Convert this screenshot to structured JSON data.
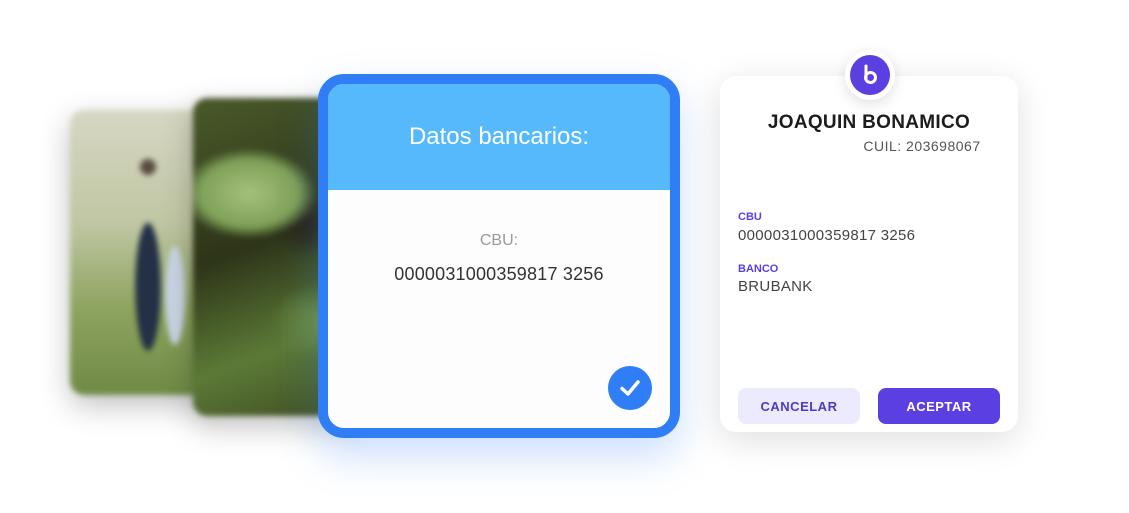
{
  "bank_card": {
    "title": "Datos bancarios:",
    "cbu_label": "CBU:",
    "cbu_value": "0000031000359817 3256",
    "check_icon": "check-circle-icon",
    "colors": {
      "border": "#2f7ef6",
      "header": "#55b9fb"
    }
  },
  "confirm_card": {
    "logo_icon": "brubank-logo-icon",
    "name": "JOAQUIN BONAMICO",
    "cuil": "CUIL: 203698067",
    "cbu_label": "CBU",
    "cbu_value": "0000031000359817 3256",
    "bank_label": "BANCO",
    "bank_value": "BRUBANK",
    "cancel_label": "CANCELAR",
    "accept_label": "ACEPTAR",
    "colors": {
      "accent": "#5b3fe0",
      "cancel_bg": "#ecebfd"
    }
  }
}
